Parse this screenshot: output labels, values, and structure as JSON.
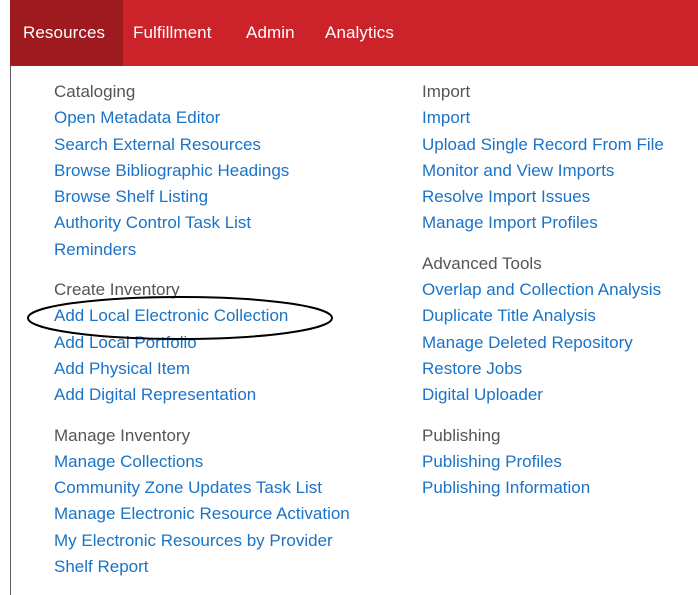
{
  "nav": {
    "tabs": [
      "Resources",
      "Fulfillment",
      "Admin",
      "Analytics"
    ],
    "active_tab": "Resources"
  },
  "columns": [
    {
      "groups": [
        {
          "heading": "Cataloging",
          "links": [
            "Open Metadata Editor",
            "Search External Resources",
            "Browse Bibliographic Headings",
            "Browse Shelf Listing",
            "Authority Control Task List",
            "Reminders"
          ]
        },
        {
          "heading": "Create Inventory",
          "links": [
            "Add Local Electronic Collection",
            "Add Local Portfolio",
            "Add Physical Item",
            "Add Digital Representation"
          ]
        },
        {
          "heading": "Manage Inventory",
          "links": [
            "Manage Collections",
            "Community Zone Updates Task List",
            "Manage Electronic Resource Activation",
            "My Electronic Resources by Provider",
            "Shelf Report"
          ]
        }
      ]
    },
    {
      "groups": [
        {
          "heading": "Import",
          "links": [
            "Import",
            "Upload Single Record From File",
            "Monitor and View Imports",
            "Resolve Import Issues",
            "Manage Import Profiles"
          ]
        },
        {
          "heading": "Advanced Tools",
          "links": [
            "Overlap and Collection Analysis",
            "Duplicate Title Analysis",
            "Manage Deleted Repository",
            "Restore Jobs",
            "Digital Uploader"
          ]
        },
        {
          "heading": "Publishing",
          "links": [
            "Publishing Profiles",
            "Publishing Information"
          ]
        }
      ]
    }
  ],
  "colors": {
    "nav_bg": "#cc2229",
    "nav_active_bg": "#9e1a1f",
    "link": "#1a73c6",
    "heading": "#555555"
  },
  "highlighted_item": "Add Local Electronic Collection"
}
